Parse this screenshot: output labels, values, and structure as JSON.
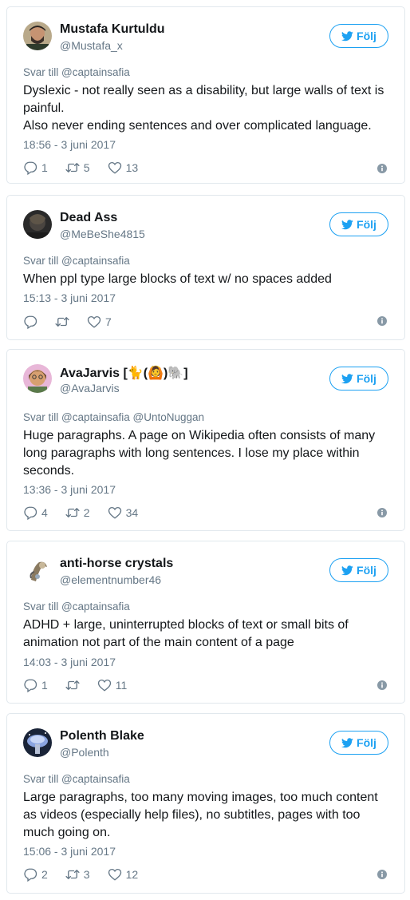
{
  "follow_label": "Följ",
  "colors": {
    "accent": "#1da1f2",
    "secondary_text": "#657786",
    "border": "#e1e8ed"
  },
  "tweets": [
    {
      "name": "Mustafa Kurtuldu",
      "handle": "@Mustafa_x",
      "replying": "Svar till @captainsafia",
      "text": [
        "Dyslexic - not really seen as a disability, but large walls of text is",
        "painful.",
        "Also never ending sentences and over complicated language."
      ],
      "time": "18:56 - 3 juni 2017",
      "replies": "1",
      "retweets": "5",
      "likes": "13"
    },
    {
      "name": "Dead Ass",
      "handle": "@MeBeShe4815",
      "replying": "Svar till @captainsafia",
      "text": [
        "When ppl type large blocks of text w/ no spaces added"
      ],
      "time": "15:13 - 3 juni 2017",
      "replies": "",
      "retweets": "",
      "likes": "7"
    },
    {
      "name": "AvaJarvis [🐈(🙆)🐘]",
      "handle": "@AvaJarvis",
      "replying": "Svar till @captainsafia @UntoNuggan",
      "text": [
        "Huge paragraphs. A page on Wikipedia often consists of many",
        "long paragraphs with long sentences. I lose my place within",
        "seconds."
      ],
      "time": "13:36 - 3 juni 2017",
      "replies": "4",
      "retweets": "2",
      "likes": "34"
    },
    {
      "name": "anti-horse crystals",
      "handle": "@elementnumber46",
      "replying": "Svar till @captainsafia",
      "text": [
        "ADHD + large, uninterrupted blocks of text or small bits of",
        "animation not part of the main content of a page"
      ],
      "time": "14:03 - 3 juni 2017",
      "replies": "1",
      "retweets": "",
      "likes": "11"
    },
    {
      "name": "Polenth Blake",
      "handle": "@Polenth",
      "replying": "Svar till @captainsafia",
      "text": [
        "Large paragraphs, too many moving images, too much content",
        "as videos (especially help files), no subtitles, pages with too",
        "much going on."
      ],
      "time": "15:06 - 3 juni 2017",
      "replies": "2",
      "retweets": "3",
      "likes": "12"
    }
  ]
}
